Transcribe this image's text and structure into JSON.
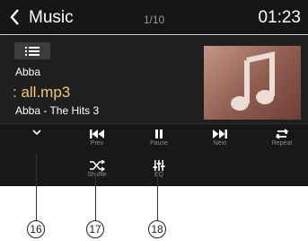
{
  "header": {
    "title": "Music",
    "track_position": "1/10",
    "clock": "01:23"
  },
  "now_playing": {
    "artist": "Abba",
    "song": ": all.mp3",
    "album": "Abba - The Hits 3"
  },
  "controls": {
    "prev_label": "Prev",
    "pause_label": "Pause",
    "next_label": "Next",
    "repeat_label": "Repeat",
    "shuffle_label": "Shuffle",
    "eq_label": "EQ"
  },
  "callouts": {
    "c16": "16",
    "c17": "17",
    "c18": "18"
  },
  "icons": [
    "back-icon",
    "playlist-icon",
    "album-art-icon",
    "collapse-icon",
    "prev-icon",
    "pause-icon",
    "next-icon",
    "repeat-icon",
    "shuffle-icon",
    "eq-icon"
  ],
  "colors": {
    "song_title": "#f2c977",
    "background": "#1f1f1f"
  }
}
